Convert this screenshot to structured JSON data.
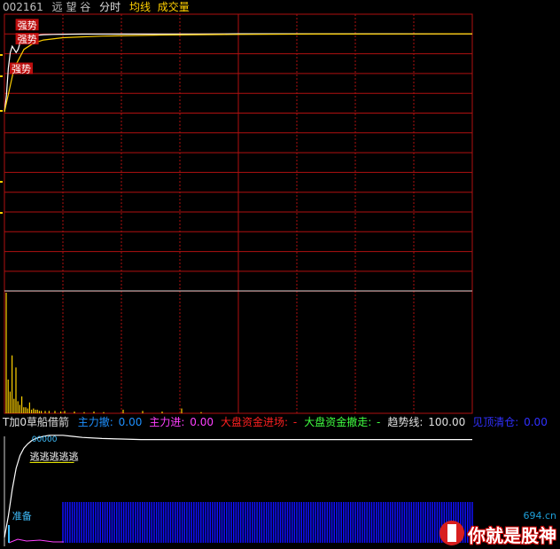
{
  "header": {
    "code": "002161",
    "name": "远 望 谷",
    "mode": "分时",
    "avg_line": "均线",
    "volume": "成交量"
  },
  "indicator": {
    "name": "T加0草船借箭",
    "items": [
      {
        "label": "主力撤:",
        "value": "0.00",
        "color": "#1e90ff"
      },
      {
        "label": "主力进:",
        "value": "0.00",
        "color": "#ff40ff"
      },
      {
        "label": "大盘资金进场:",
        "value": "-",
        "color": "#ff2020"
      },
      {
        "label": "大盘资金撤走:",
        "value": "-",
        "color": "#40ff40"
      },
      {
        "label": "趋势线:",
        "value": "100.00",
        "color": "#e0e0e0"
      },
      {
        "label": "见顶清仓:",
        "value": "0.00",
        "color": "#3030ff"
      }
    ]
  },
  "watermark": {
    "site": "694.cn",
    "text": "你就是股神"
  },
  "colors": {
    "grid": "#b01010",
    "price": "#ffffff",
    "avg": "#ffd000",
    "volume": "#ffd000",
    "tag": "#ffffff",
    "tag_bg": "#d01010",
    "blue_bars": "#1010ff",
    "trend": "#ffffff"
  },
  "chart_data": [
    {
      "type": "line",
      "panel": "price",
      "x_range": [
        0,
        240
      ],
      "ylim": [
        0,
        100
      ],
      "series": [
        {
          "role": "price",
          "x": [
            0,
            1,
            2,
            3,
            4,
            5,
            6,
            7,
            8,
            9,
            10,
            12,
            14,
            16,
            18,
            20,
            25,
            30,
            40,
            60,
            80,
            100,
            120,
            150,
            180,
            210,
            240
          ],
          "y": [
            42,
            52,
            70,
            80,
            84,
            82,
            80,
            82,
            86,
            89,
            90,
            90.5,
            90.8,
            91,
            91.2,
            91.4,
            91.6,
            91.7,
            91.8,
            91.8,
            91.9,
            91.9,
            92,
            92,
            92,
            92,
            92
          ]
        },
        {
          "role": "average",
          "x": [
            0,
            5,
            10,
            15,
            20,
            30,
            50,
            80,
            120,
            160,
            200,
            240
          ],
          "y": [
            42,
            70,
            82,
            86,
            88,
            89.5,
            90.5,
            91.2,
            91.6,
            91.8,
            91.9,
            92
          ]
        }
      ],
      "annotations": [
        {
          "text": "强势",
          "x": 3,
          "y": 97
        },
        {
          "text": "强势",
          "x": 3,
          "y": 88
        },
        {
          "text": "强势",
          "x": 0,
          "y": 69
        }
      ]
    },
    {
      "type": "bar",
      "panel": "volume",
      "x_range": [
        0,
        240
      ],
      "ylim": [
        0,
        100
      ],
      "x": [
        0,
        1,
        2,
        3,
        4,
        5,
        6,
        7,
        8,
        9,
        10,
        11,
        12,
        13,
        14,
        15,
        16,
        17,
        18,
        20,
        22,
        25,
        28,
        30,
        35,
        40,
        45,
        50,
        60,
        70,
        80,
        90,
        100
      ],
      "values": [
        100,
        28,
        18,
        48,
        12,
        38,
        10,
        7,
        14,
        5,
        5,
        4,
        9,
        3,
        4,
        3,
        3,
        2,
        2,
        2,
        2,
        2,
        1.5,
        2,
        1.5,
        1,
        1.5,
        1,
        3,
        2,
        1.5,
        4,
        1
      ]
    },
    {
      "type": "line",
      "panel": "indicator",
      "x_range": [
        0,
        240
      ],
      "ylim": [
        0,
        100
      ],
      "series": [
        {
          "role": "trend",
          "x": [
            0,
            2,
            4,
            6,
            8,
            10,
            12,
            14,
            16,
            18,
            20,
            23,
            26,
            30,
            35,
            40,
            50,
            60,
            70,
            80,
            100,
            120,
            160,
            200,
            240
          ],
          "y": [
            5,
            25,
            50,
            70,
            82,
            89,
            93,
            96,
            98,
            99,
            100,
            101,
            101,
            101,
            100,
            99,
            98,
            97.5,
            97,
            97,
            97,
            97,
            97,
            97,
            97
          ]
        }
      ],
      "annotations": [
        {
          "text": "逃逃逃逃逃",
          "x": 13,
          "y": 78
        },
        {
          "text": "准备",
          "x": 4,
          "y": 22
        },
        {
          "text": "00000",
          "x": 14,
          "y": 95
        }
      ],
      "blue_bars": {
        "x_start": 30,
        "x_end": 240,
        "height": 40
      }
    }
  ]
}
